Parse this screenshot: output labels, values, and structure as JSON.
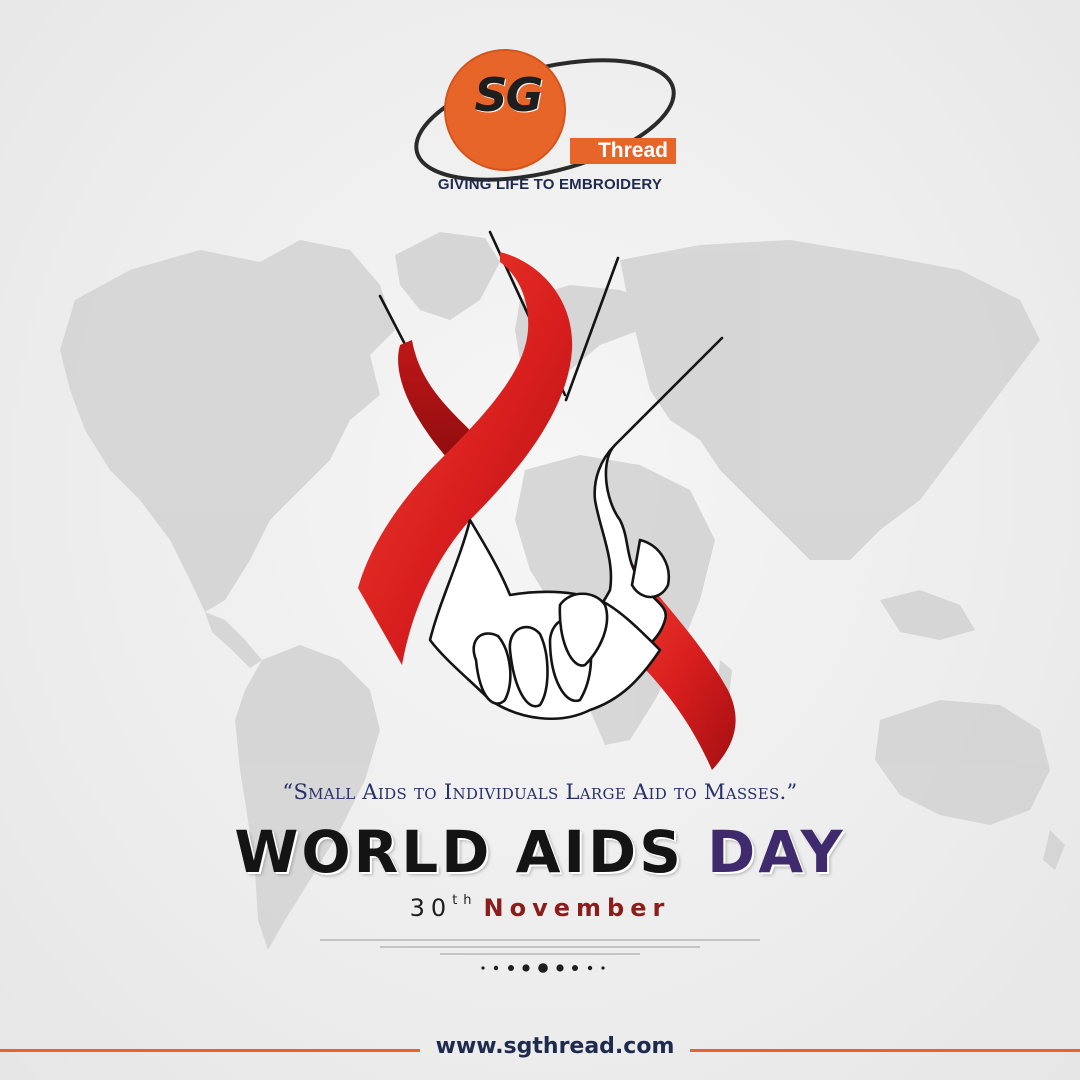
{
  "brand": {
    "logo_letters": "SG",
    "logo_word": "Thread",
    "tagline": "GIVING LIFE TO EMBROIDERY",
    "accent_color": "#e8652a",
    "navy_color": "#1f2a4f"
  },
  "poster": {
    "quote": "“Small Aids to Individuals Large Aid to Masses.”",
    "headline_main": "WORLD AIDS",
    "headline_accent": "DAY",
    "date_day": "30",
    "date_suffix": "th",
    "date_month": "November",
    "ribbon_color": "#d81e1e",
    "headline_accent_color": "#3f2a6e",
    "month_color": "#8b1d1d"
  },
  "footer": {
    "website": "www.sgthread.com"
  },
  "icons": {
    "background": "world-map-icon",
    "ribbon": "awareness-ribbon-icon",
    "hands": "holding-hands-icon"
  }
}
